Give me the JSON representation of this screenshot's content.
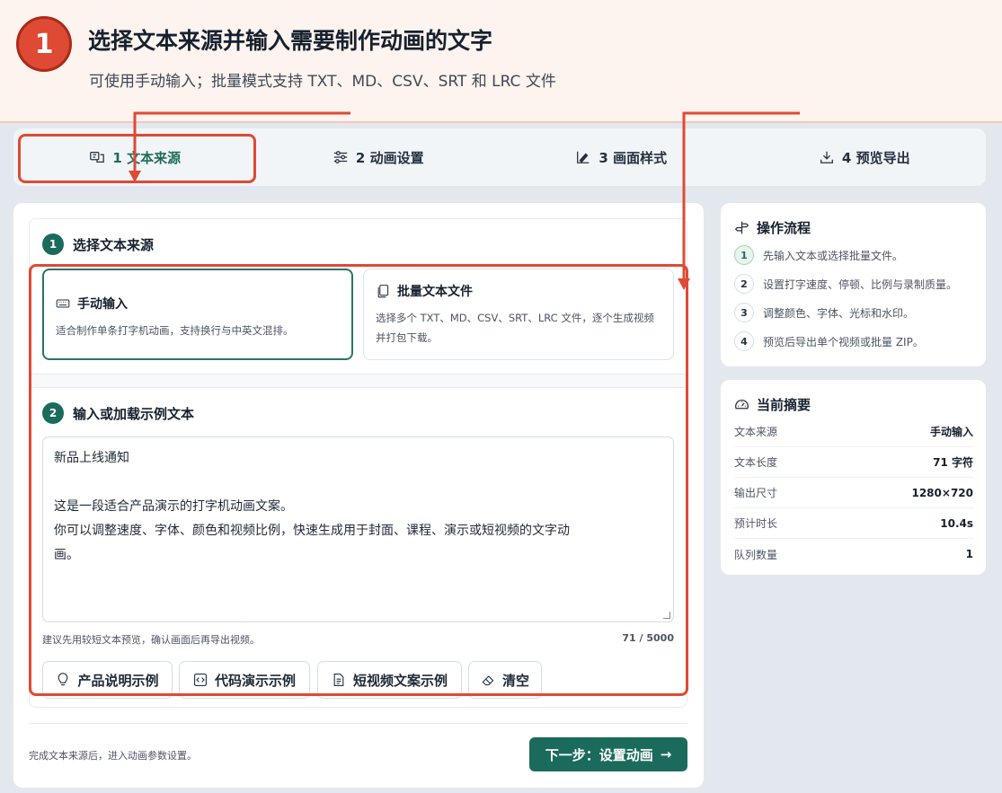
{
  "banner": {
    "step_number": "1",
    "title": "选择文本来源并输入需要制作动画的文字",
    "subtitle": "可使用手动输入；批量模式支持 TXT、MD、CSV、SRT 和 LRC 文件"
  },
  "tabs": [
    {
      "label": "1 文本来源",
      "icon": "text-source-icon",
      "active": true
    },
    {
      "label": "2 动画设置",
      "icon": "sliders-icon",
      "active": false
    },
    {
      "label": "3 画面样式",
      "icon": "brush-icon",
      "active": false
    },
    {
      "label": "4 预览导出",
      "icon": "download-icon",
      "active": false
    }
  ],
  "source": {
    "step": "1",
    "heading": "选择文本来源",
    "options": [
      {
        "title": "手动输入",
        "icon": "keyboard-icon",
        "desc": "适合制作单条打字机动画，支持换行与中英文混排。",
        "selected": true
      },
      {
        "title": "批量文本文件",
        "icon": "files-icon",
        "desc_lines": [
          "选择多个 TXT、MD、CSV、SRT、LRC 文件，逐个生成视频",
          "并打包下载。"
        ],
        "selected": false
      }
    ]
  },
  "input": {
    "step": "2",
    "heading": "输入或加载示例文本",
    "lines": [
      "新品上线通知",
      "",
      "这是一段适合产品演示的打字机动画文案。",
      "你可以调整速度、字体、颜色和视频比例，快速生成用于封面、课程、演示或短视频的文字动",
      "画。"
    ],
    "hint": "建议先用较短文本预览，确认画面后再导出视频。",
    "count": "71 / 5000"
  },
  "examples": [
    {
      "label": "产品说明示例",
      "icon": "lightbulb-icon"
    },
    {
      "label": "代码演示示例",
      "icon": "code-icon"
    },
    {
      "label": "短视频文案示例",
      "icon": "document-icon"
    },
    {
      "label": "清空",
      "icon": "eraser-icon"
    }
  ],
  "footer": {
    "hint": "完成文本来源后，进入动画参数设置。",
    "next_label": "下一步：设置动画",
    "next_arrow": "→"
  },
  "flow": {
    "title": "操作流程",
    "icon": "signpost-icon",
    "items": [
      {
        "num": "1",
        "text": "先输入文本或选择批量文件。",
        "active": true
      },
      {
        "num": "2",
        "text": "设置打字速度、停顿、比例与录制质量。",
        "active": false
      },
      {
        "num": "3",
        "text": "调整颜色、字体、光标和水印。",
        "active": false
      },
      {
        "num": "4",
        "text": "预览后导出单个视频或批量 ZIP。",
        "active": false
      }
    ]
  },
  "summary": {
    "title": "当前摘要",
    "icon": "gauge-icon",
    "rows": [
      {
        "label": "文本来源",
        "value": "手动输入"
      },
      {
        "label": "文本长度",
        "value": "71 字符"
      },
      {
        "label": "输出尺寸",
        "value": "1280×720"
      },
      {
        "label": "预计时长",
        "value": "10.4s"
      },
      {
        "label": "队列数量",
        "value": "1"
      }
    ]
  },
  "colors": {
    "accent": "#1b6b5c",
    "annotation": "#df4a34",
    "banner_bg": "#fdf3ef"
  }
}
